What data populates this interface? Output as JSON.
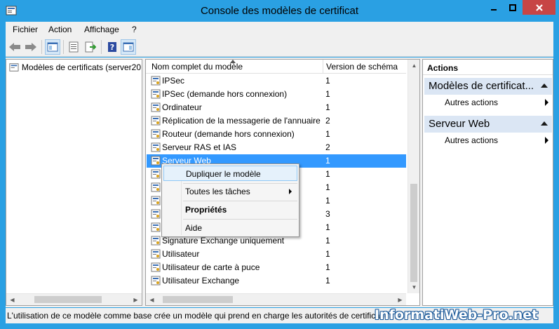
{
  "window": {
    "title": "Console des modèles de certificat"
  },
  "menu": [
    "Fichier",
    "Action",
    "Affichage",
    "?"
  ],
  "tree": {
    "root_label": "Modèles de certificats (server20"
  },
  "list": {
    "columns": [
      "Nom complet du modèle",
      "Version de schéma"
    ],
    "rows": [
      {
        "name": "IPSec",
        "version": "1"
      },
      {
        "name": "IPSec (demande hors connexion)",
        "version": "1"
      },
      {
        "name": "Ordinateur",
        "version": "1"
      },
      {
        "name": "Réplication de la messagerie de l'annuaire",
        "version": "2"
      },
      {
        "name": "Routeur (demande hors connexion)",
        "version": "1"
      },
      {
        "name": "Serveur RAS et IAS",
        "version": "2"
      },
      {
        "name": "Serveur Web",
        "version": "1",
        "selected": true
      },
      {
        "name": "",
        "version": "1"
      },
      {
        "name": "",
        "version": "1"
      },
      {
        "name": "",
        "version": "1"
      },
      {
        "name": "",
        "version": "3"
      },
      {
        "name": "",
        "version": "1"
      },
      {
        "name": "Signature Exchange uniquement",
        "version": "1"
      },
      {
        "name": "Utilisateur",
        "version": "1"
      },
      {
        "name": "Utilisateur de carte à puce",
        "version": "1"
      },
      {
        "name": "Utilisateur Exchange",
        "version": "1"
      }
    ]
  },
  "actions": {
    "title": "Actions",
    "sections": [
      {
        "label": "Modèles de certificat...",
        "items": [
          "Autres actions"
        ]
      },
      {
        "label": "Serveur Web",
        "items": [
          "Autres actions"
        ]
      }
    ]
  },
  "context_menu": {
    "items": [
      "Dupliquer le modèle",
      "Toutes les tâches",
      "Propriétés",
      "Aide"
    ]
  },
  "status": {
    "text": "L'utilisation de ce modèle comme base crée un modèle qui prend en charge les autorités de certification V"
  },
  "watermark": {
    "text": "InformatiWeb-Pro.net"
  },
  "colors": {
    "title_bar": "#2aa0e3",
    "selection": "#3399ff",
    "close_button": "#c74545",
    "section_bg": "#dbe6f4"
  }
}
